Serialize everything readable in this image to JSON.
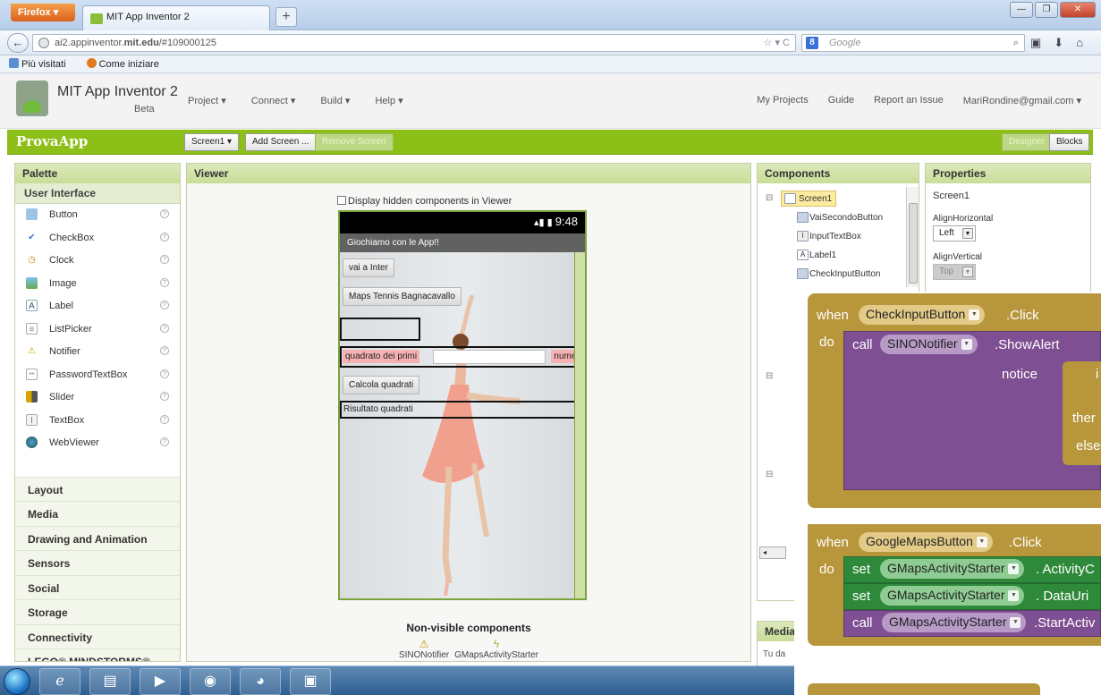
{
  "browser": {
    "firefox_label": "Firefox",
    "tab_title": "MIT App Inventor 2",
    "new_tab": "+",
    "url_prefix": "ai2.appinventor.",
    "url_domain": "mit.edu",
    "url_suffix": "/#109000125",
    "search_engine": "8",
    "search_placeholder": "Google",
    "bookmarks": [
      "Più visitati",
      "Come iniziare"
    ]
  },
  "app_header": {
    "title": "MIT App Inventor 2",
    "beta": "Beta",
    "menu": [
      "Project ▾",
      "Connect ▾",
      "Build ▾",
      "Help ▾"
    ],
    "right_links": [
      "My Projects",
      "Guide",
      "Report an Issue",
      "MariRondine@gmail.com ▾"
    ]
  },
  "project_bar": {
    "project_name": "ProvaApp",
    "screen_select": "Screen1 ▾",
    "add_screen": "Add Screen ...",
    "remove_screen": "Remove Screen",
    "designer": "Designer",
    "blocks": "Blocks"
  },
  "palette": {
    "title": "Palette",
    "open_category": "User Interface",
    "items": [
      "Button",
      "CheckBox",
      "Clock",
      "Image",
      "Label",
      "ListPicker",
      "Notifier",
      "PasswordTextBox",
      "Slider",
      "TextBox",
      "WebViewer"
    ],
    "help_glyph": "?",
    "categories": [
      "Layout",
      "Media",
      "Drawing and Animation",
      "Sensors",
      "Social",
      "Storage",
      "Connectivity",
      "LEGO® MINDSTORMS®"
    ]
  },
  "viewer": {
    "title": "Viewer",
    "display_hidden": "Display hidden components in Viewer",
    "status_time": "9:48",
    "app_title": "Giochiamo con le App!!",
    "btn_inter": "vai a Inter",
    "btn_maps": "Maps Tennis Bagnacavallo",
    "lbl_quadrato": "quadrato dei primi",
    "lbl_numeri": "numeri",
    "btn_calcola": "Calcola quadrati",
    "lbl_risultato": "Risultato quadrati",
    "nonvisible_title": "Non-visible components",
    "nonvisible": [
      "SINONotifier",
      "GMapsActivityStarter"
    ]
  },
  "components": {
    "title": "Components",
    "tree": [
      "Screen1",
      "VaiSecondoButton",
      "InputTextBox",
      "Label1",
      "CheckInputButton"
    ]
  },
  "media": {
    "title": "Media",
    "text": "Tu da"
  },
  "properties": {
    "title": "Properties",
    "screen": "Screen1",
    "align_h_label": "AlignHorizontal",
    "align_h_value": "Left",
    "align_v_label": "AlignVertical",
    "align_v_value": "Top"
  },
  "blocks": {
    "b1": {
      "when": "when",
      "component": "CheckInputButton",
      "event": ".Click",
      "do": "do",
      "call": "call",
      "target": "SINONotifier",
      "method": ".ShowAlert",
      "notice": "notice",
      "i": "i",
      "then": "ther",
      "else": "else"
    },
    "b2": {
      "when": "when",
      "component": "GoogleMapsButton",
      "event": ".Click",
      "do": "do",
      "set1": "set",
      "target1": "GMapsActivityStarter",
      "prop1": ". ActivityC",
      "set2": "set",
      "target2": "GMapsActivityStarter",
      "prop2": ". DataUri",
      "call": "call",
      "target3": "GMapsActivityStarter",
      "method": ".StartActiv"
    }
  }
}
